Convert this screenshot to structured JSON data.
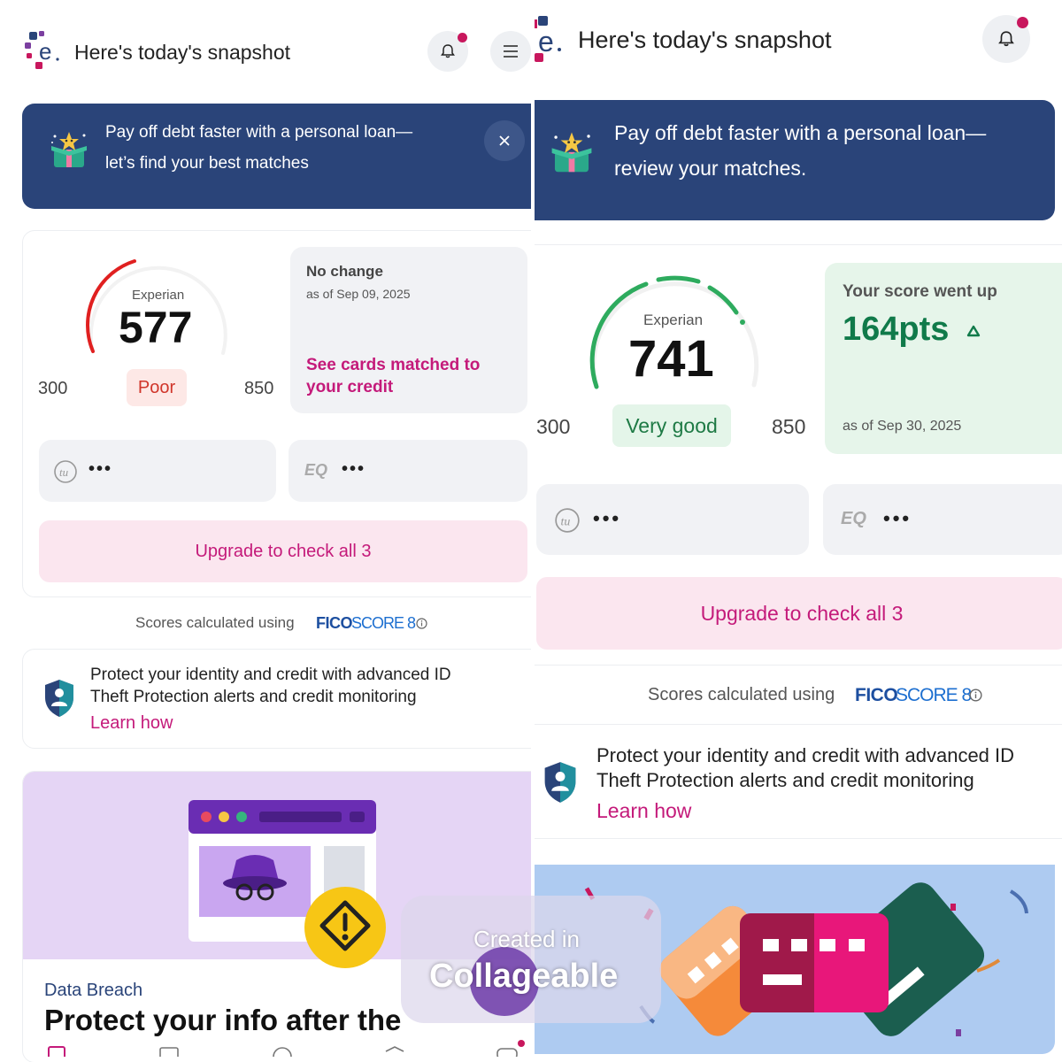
{
  "header": {
    "title": "Here's today's snapshot"
  },
  "banner": {
    "left_line1": "Pay off debt faster with a personal loan—",
    "left_line2": "let’s find your best matches",
    "right_line1": "Pay off debt faster with a personal loan—",
    "right_line2": "review your matches."
  },
  "left_score": {
    "bureau": "Experian",
    "score": "577",
    "range_min": "300",
    "range_max": "850",
    "rating": "Poor",
    "change_title": "No change",
    "change_date": "as of Sep 09, 2025",
    "cta_line1": "See cards matched to",
    "cta_line2": "your credit"
  },
  "right_score": {
    "bureau": "Experian",
    "score": "741",
    "range_min": "300",
    "range_max": "850",
    "rating": "Very good",
    "change_title": "Your score went up",
    "change_value": "164pts",
    "change_date": "as of Sep 30, 2025"
  },
  "bureaus": {
    "tu_logo": "tu",
    "eq_logo": "EQ",
    "placeholder": "•••"
  },
  "upgrade_label": "Upgrade to check all 3",
  "fico": {
    "prefix": "Scores calculated using",
    "brand": "FICO",
    "product": "SCORE 8"
  },
  "identity": {
    "line1": "Protect your identity and credit with advanced ID",
    "line2": "Theft Protection alerts and credit monitoring",
    "link": "Learn how"
  },
  "article": {
    "category": "Data Breach",
    "headline": "Protect your info after the"
  },
  "watermark": {
    "line1": "Created in",
    "line2": "Collageable"
  },
  "colors": {
    "brand_navy": "#2a4479",
    "brand_pink": "#c41a7a",
    "poor_red": "#e02020",
    "good_green": "#2eab5e"
  }
}
